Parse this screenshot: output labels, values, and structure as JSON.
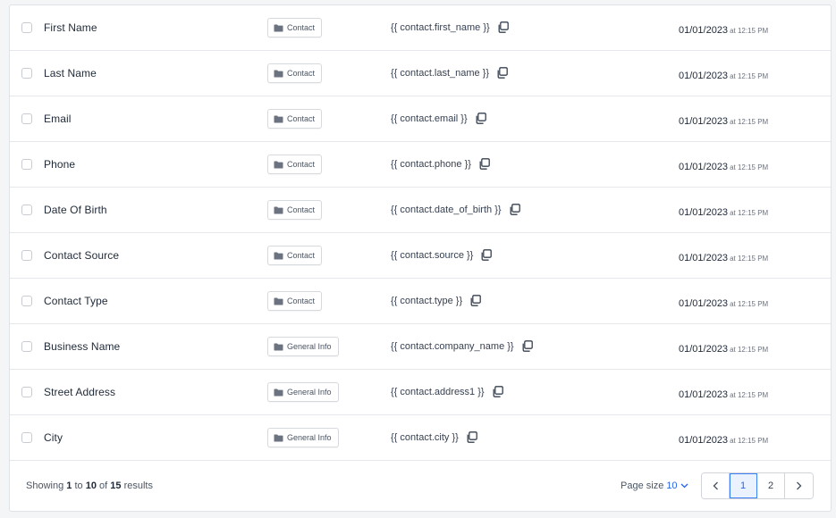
{
  "rows": [
    {
      "name": "First Name",
      "folder": "Contact",
      "merge_field": "{{ contact.first_name }}",
      "date": "01/01/2023",
      "time": "at 12:15 PM"
    },
    {
      "name": "Last Name",
      "folder": "Contact",
      "merge_field": "{{ contact.last_name }}",
      "date": "01/01/2023",
      "time": "at 12:15 PM"
    },
    {
      "name": "Email",
      "folder": "Contact",
      "merge_field": "{{ contact.email }}",
      "date": "01/01/2023",
      "time": "at 12:15 PM"
    },
    {
      "name": "Phone",
      "folder": "Contact",
      "merge_field": "{{ contact.phone }}",
      "date": "01/01/2023",
      "time": "at 12:15 PM"
    },
    {
      "name": "Date Of Birth",
      "folder": "Contact",
      "merge_field": "{{ contact.date_of_birth }}",
      "date": "01/01/2023",
      "time": "at 12:15 PM"
    },
    {
      "name": "Contact Source",
      "folder": "Contact",
      "merge_field": "{{ contact.source }}",
      "date": "01/01/2023",
      "time": "at 12:15 PM"
    },
    {
      "name": "Contact Type",
      "folder": "Contact",
      "merge_field": "{{ contact.type }}",
      "date": "01/01/2023",
      "time": "at 12:15 PM"
    },
    {
      "name": "Business Name",
      "folder": "General Info",
      "merge_field": "{{ contact.company_name }}",
      "date": "01/01/2023",
      "time": "at 12:15 PM"
    },
    {
      "name": "Street Address",
      "folder": "General Info",
      "merge_field": "{{ contact.address1 }}",
      "date": "01/01/2023",
      "time": "at 12:15 PM"
    },
    {
      "name": "City",
      "folder": "General Info",
      "merge_field": "{{ contact.city }}",
      "date": "01/01/2023",
      "time": "at 12:15 PM"
    }
  ],
  "footer": {
    "showing_prefix": "Showing",
    "from": "1",
    "to_word": "to",
    "to": "10",
    "of_word": "of",
    "total": "15",
    "results_word": "results",
    "page_size_label": "Page size",
    "page_size_value": "10",
    "pages": [
      "1",
      "2"
    ],
    "current_page": "1"
  },
  "icons": {
    "folder": "folder-icon",
    "copy": "copy-icon",
    "prev": "chevron-left-icon",
    "next": "chevron-right-icon",
    "dropdown": "chevron-down-icon"
  },
  "colors": {
    "accent": "#2563eb",
    "active_page_bg": "#eaf2ff"
  }
}
